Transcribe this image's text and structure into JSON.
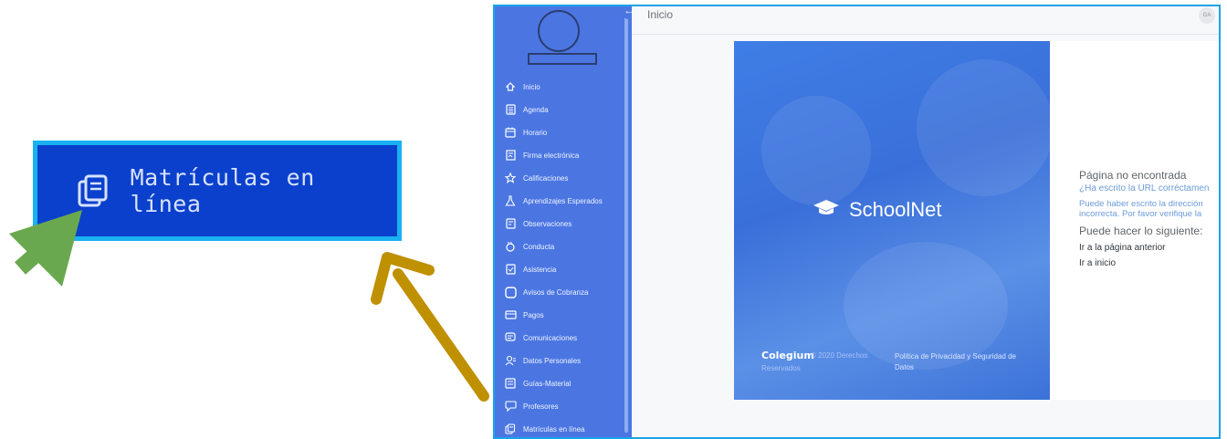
{
  "callout": {
    "label": "Matrículas en línea",
    "icon": "enrollment-icon"
  },
  "sidebar": {
    "items": [
      {
        "label": "Inicio",
        "icon": "home-icon"
      },
      {
        "label": "Agenda",
        "icon": "agenda-icon"
      },
      {
        "label": "Horario",
        "icon": "calendar-icon"
      },
      {
        "label": "Firma electrónica",
        "icon": "signature-icon"
      },
      {
        "label": "Calificaciones",
        "icon": "star-icon"
      },
      {
        "label": "Aprendizajes Esperados",
        "icon": "flask-icon"
      },
      {
        "label": "Observaciones",
        "icon": "note-icon"
      },
      {
        "label": "Conducta",
        "icon": "hand-icon"
      },
      {
        "label": "Asistencia",
        "icon": "checklist-icon"
      },
      {
        "label": "Avisos de Cobranza",
        "icon": "notice-icon"
      },
      {
        "label": "Pagos",
        "icon": "card-icon"
      },
      {
        "label": "Comunicaciones",
        "icon": "message-icon"
      },
      {
        "label": "Datos Personales",
        "icon": "user-icon"
      },
      {
        "label": "Guías-Material",
        "icon": "guide-icon"
      },
      {
        "label": "Profesores",
        "icon": "chat-icon"
      },
      {
        "label": "Matrículas en línea",
        "icon": "enrollment-icon"
      }
    ]
  },
  "topbar": {
    "breadcrumb": "Inicio",
    "user_initials": "GA"
  },
  "hero": {
    "logo_text": "SchoolNet",
    "footer_brand": "Colegium",
    "footer_copy": "© 2020  Derechos",
    "footer_reserved": "Reservados",
    "footer_privacy": "Política de Privacidad y Seguridad de Datos"
  },
  "error": {
    "title": "Página no encontrada",
    "question": "¿Ha escrito la URL corréctamen",
    "hint_line1": "Puede haber escrito la dirección",
    "hint_line2": "incorrecta. Por favor verifique la",
    "suggest": "Puede hacer lo siguiente:",
    "link_back": "Ir a la página anterior",
    "link_home": "Ir a inicio"
  },
  "colors": {
    "sidebar": "#4b76e2",
    "callout_bg": "#0a40cc",
    "callout_border": "#18b2f2",
    "green_arrow": "#6aa84f",
    "gold_arrow": "#bf9000"
  }
}
